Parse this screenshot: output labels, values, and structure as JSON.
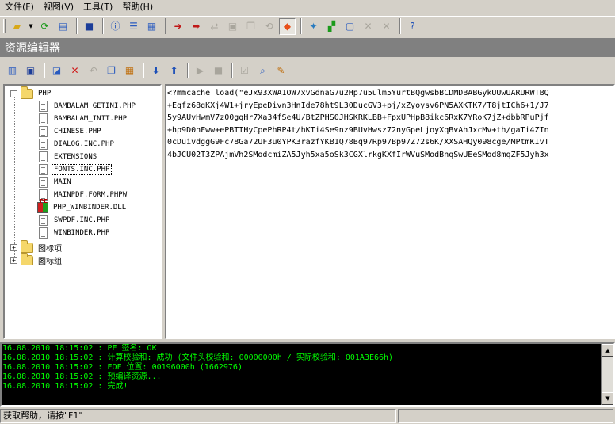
{
  "menu": [
    {
      "label": "文件(F)"
    },
    {
      "label": "视图(V)"
    },
    {
      "label": "工具(T)"
    },
    {
      "label": "帮助(H)"
    }
  ],
  "panel_title": "资源编辑器",
  "tree": {
    "root": {
      "label": "PHP",
      "toggle": "−"
    },
    "files": [
      {
        "label": "BAMBALAM_GETINI.PHP",
        "icon": "file-icon"
      },
      {
        "label": "BAMBALAM_INIT.PHP",
        "icon": "file-icon"
      },
      {
        "label": "CHINESE.PHP",
        "icon": "file-icon"
      },
      {
        "label": "DIALOG.INC.PHP",
        "icon": "file-icon"
      },
      {
        "label": "EXTENSIONS",
        "icon": "file-icon"
      },
      {
        "label": "FONTS.INC.PHP",
        "icon": "file-icon",
        "selected": true
      },
      {
        "label": "MAIN",
        "icon": "file-icon"
      },
      {
        "label": "MAINPDF.FORM.PHPW",
        "icon": "file-icon"
      },
      {
        "label": "PHP_WINBINDER.DLL",
        "icon": "dll-icon"
      },
      {
        "label": "SWPDF.INC.PHP",
        "icon": "file-icon"
      },
      {
        "label": "WINBINDER.PHP",
        "icon": "file-icon"
      }
    ],
    "groups": [
      {
        "label": "图标项",
        "toggle": "+"
      },
      {
        "label": "图标组",
        "toggle": "+"
      }
    ]
  },
  "editor": {
    "lines": [
      "<?mmcache_load(\"eJx93XWA1OW7xvGdnaG7u2Hp7u5ulm5YurtBQgwsbBCDMDBABGykUUwUARURWTBQ",
      "+Eqfz68gKXj4W1+jryEpeDivn3HnIde78ht9L30DucGV3+pj/xZyoysv6PN5AXKTK7/T8jtICh6+1/J7",
      "5y9AUvHwmV7z00gqHr7Xa34fSe4U/BtZPHS0JHSKRKLBB+FpxUPHpB8ikc6RxK7YRoK7jZ+dbbRPuPjf",
      "+hp9D0nFww+ePBTIHyCpePhRP4t/hKTi4Se9nz9BUvHwsz72nyGpeLjoyXqBvAhJxcMv+th/gaTi4ZIn",
      "0cDuivdggG9Fc78Ga72UF3u0YPK3razfYKB1Q78Bq97Rp97Bp97Z72s6K/XXSAHQy098cge/MPtmKIvT",
      "4bJCU02T3ZPAjmVh2SModcmiZA5Jyh5xa5oSk3CGXlrkgKXfIrWVuSModBnqSwUEeSMod8mqZF5Jyh3x"
    ]
  },
  "log": [
    "16.08.2010 18:15:02 : PE 签名: OK",
    "16.08.2010 18:15:02 : 计算校验和: 成功 (文件头校验和: 00000000h / 实际校验和: 001A3E66h)",
    "16.08.2010 18:15:02 : EOF 位置: 00196000h  (1662976)",
    "16.08.2010 18:15:02 : 预编译资源...",
    "16.08.2010 18:15:02 : 完成!"
  ],
  "status": {
    "help_text": "获取帮助，请按\"F1\""
  },
  "colors": {
    "log_text": "#00ff00",
    "log_background": "#000000",
    "title_bar": "#808080",
    "window_face": "#d4d0c8"
  }
}
